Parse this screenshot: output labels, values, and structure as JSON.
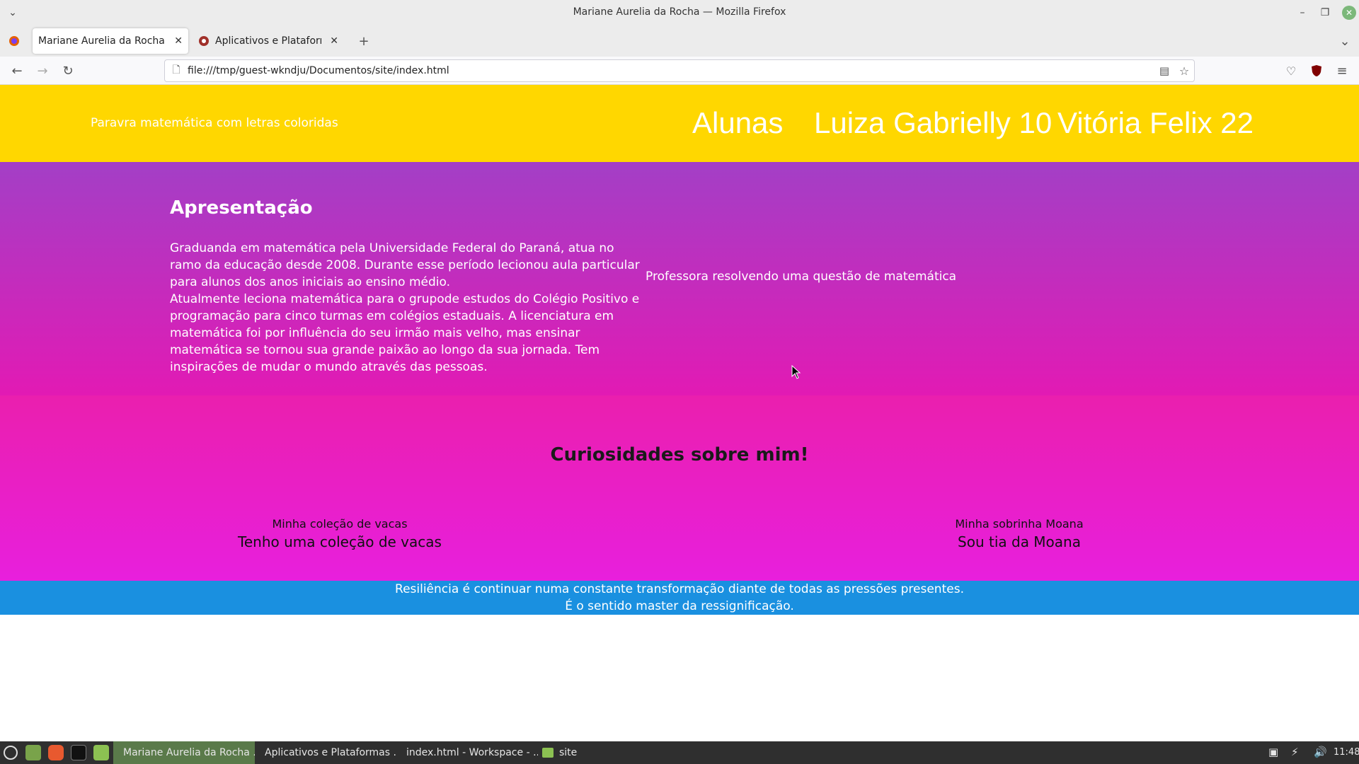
{
  "window": {
    "title": "Mariane Aurelia da Rocha — Mozilla Firefox"
  },
  "tabs": [
    {
      "label": "Mariane Aurelia da Rocha"
    },
    {
      "label": "Aplicativos e Plataformas Ed"
    }
  ],
  "navigation": {
    "url": "file:///tmp/guest-wkndju/Documentos/site/index.html"
  },
  "site": {
    "header": {
      "logo_alt": "Paravra matemática com letras coloridas",
      "nav": [
        "Alunas",
        "Luiza Gabrielly 10",
        "Vitória Felix 22"
      ]
    },
    "presentation": {
      "title": "Apresentação",
      "paragraph1": "Graduanda em matemática pela Universidade Federal do Paraná, atua no ramo da educação desde 2008. Durante esse período lecionou aula particular para alunos dos anos iniciais ao ensino médio.",
      "paragraph2": "Atualmente leciona matemática para o grupode estudos do Colégio Positivo e programação para cinco turmas em colégios estaduais. A licenciatura em matemática foi por influência do seu irmão mais velho, mas ensinar matemática se tornou sua grande paixão ao longo da sua jornada. Tem inspirações de mudar o mundo através das pessoas.",
      "image_alt": "Professora resolvendo uma questão de matemática"
    },
    "curiosities": {
      "title": "Curiosidades sobre mim!",
      "items": [
        {
          "image_alt": "Minha coleção de vacas",
          "caption": "Tenho uma coleção de vacas"
        },
        {
          "image_alt": "Minha sobrinha Moana",
          "caption": "Sou tia da Moana"
        }
      ]
    },
    "footer": {
      "line1": "Resiliência é continuar numa constante transformação diante de todas as pressões presentes.",
      "line2": "É o sentido master da ressignificação."
    }
  },
  "taskbar": {
    "windows": [
      "Mariane Aurelia da Rocha ...",
      "Aplicativos e Plataformas ...",
      "index.html - Workspace - ...",
      "site"
    ],
    "clock": "11:48"
  },
  "colors": {
    "header_bg": "#ffd700",
    "presentation_gradient": [
      "#a33fc6",
      "#e21ab4"
    ],
    "curiosities_gradient": [
      "#ea1fae",
      "#e81fdd"
    ],
    "footer_bg": "#1a90e0"
  }
}
